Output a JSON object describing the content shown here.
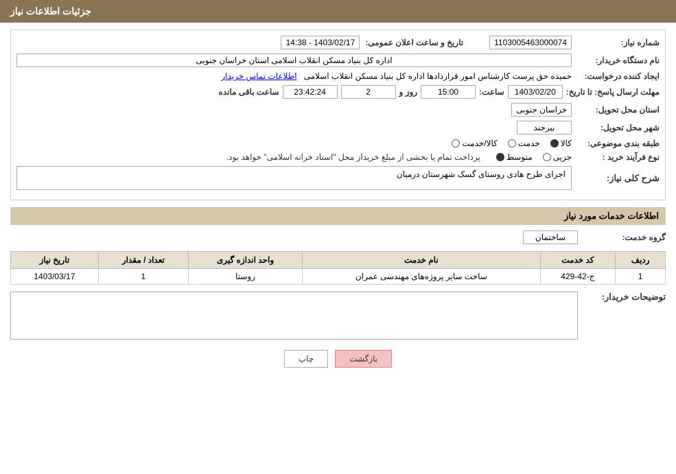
{
  "header": {
    "title": "جزئیات اطلاعات نیاز"
  },
  "fields": {
    "need_number_label": "شماره نیاز:",
    "need_number_value": "1103005463000074",
    "announcement_date_label": "تاریخ و ساعت اعلان عمومی:",
    "announcement_date_value": "1403/02/17 - 14:38",
    "org_name_label": "نام دستگاه خریدار:",
    "org_name_value": "اداره کل بنیاد مسکن انقلاب اسلامی استان خراسان جنوبی",
    "creator_label": "ایجاد کننده درخواست:",
    "creator_value": "حمیده حق پرست کارشناس امور قراردادها اداره کل بنیاد مسکن انقلاب اسلامی",
    "creator_link": "اطلاعات تماس خریدار",
    "response_deadline_label": "مهلت ارسال پاسخ: تا تاریخ:",
    "response_date": "1403/02/20",
    "response_time_label": "ساعت:",
    "response_time": "15:00",
    "response_days_label": "روز و",
    "response_days": "2",
    "response_seconds": "23:42:24",
    "response_remaining_label": "ساعت باقی مانده",
    "province_label": "استان محل تحویل:",
    "province_value": "خراسان جنوبی",
    "city_label": "شهر محل تحویل:",
    "city_value": "بیرجند",
    "category_label": "طبقه بندی موضوعی:",
    "category_options": [
      {
        "label": "کالا",
        "selected": true
      },
      {
        "label": "خدمت",
        "selected": false
      },
      {
        "label": "کالا/خدمت",
        "selected": false
      }
    ],
    "purchase_type_label": "نوع فرآیند خرید :",
    "purchase_options": [
      {
        "label": "جزیی",
        "selected": false
      },
      {
        "label": "متوسط",
        "selected": true
      },
      {
        "label": ""
      }
    ],
    "purchase_note": "پرداخت تمام یا بخشی از مبلغ خریداز محل \"اسناد خزانه اسلامی\" خواهد بود.",
    "general_desc_label": "شرح کلی نیاز:",
    "general_desc_value": "اجرای طرح هادی روستای گسک شهرستان درمیان",
    "services_title": "اطلاعات خدمات مورد نیاز",
    "service_group_label": "گروه خدمت:",
    "service_group_value": "ساختمان",
    "table_headers": [
      "ردیف",
      "کد خدمت",
      "نام خدمت",
      "واحد اندازه گیری",
      "تعداد / مقدار",
      "تاریخ نیاز"
    ],
    "table_rows": [
      {
        "row": "1",
        "code": "ج-42-429",
        "name": "ساخت سایر پروژه‌های مهندسی عمران",
        "unit": "روستا",
        "qty": "1",
        "date": "1403/03/17"
      }
    ],
    "buyer_desc_label": "توضیحات خریدار:",
    "buyer_desc_value": "",
    "btn_back": "بازگشت",
    "btn_print": "چاپ"
  }
}
